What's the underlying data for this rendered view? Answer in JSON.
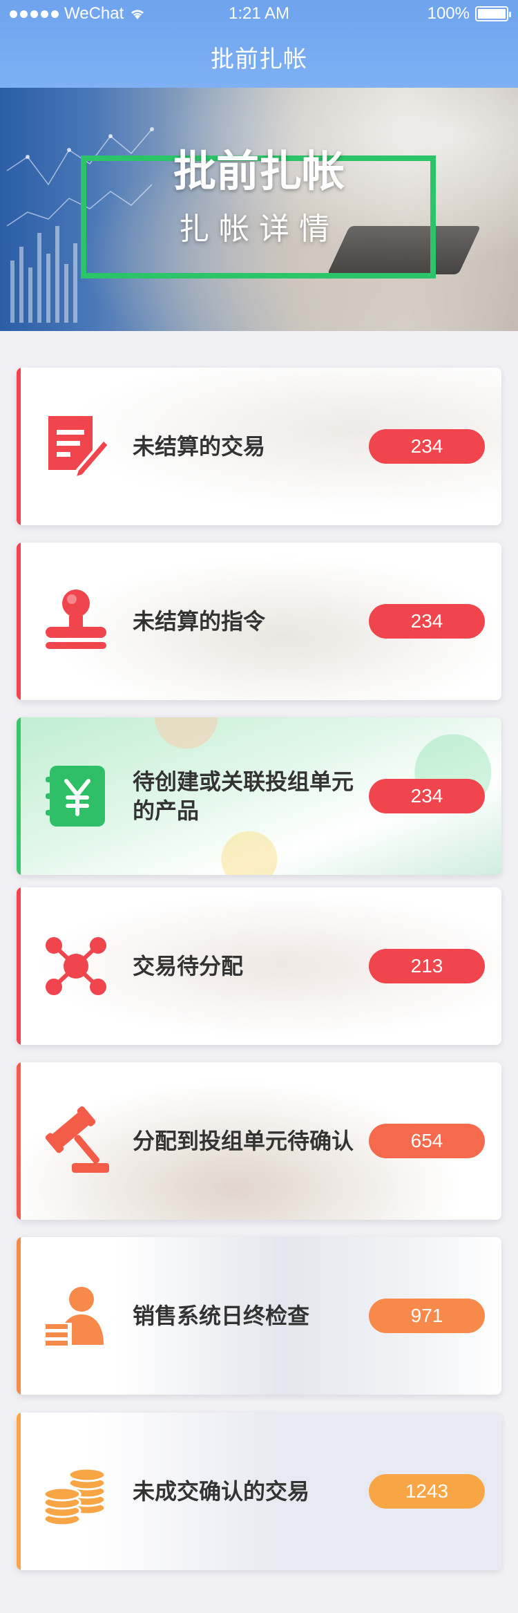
{
  "status_bar": {
    "carrier": "WeChat",
    "time": "1:21 AM",
    "battery": "100%"
  },
  "nav": {
    "title": "批前扎帐"
  },
  "banner": {
    "title": "批前扎帐",
    "subtitle": "扎帐详情"
  },
  "items": [
    {
      "label": "未结算的交易",
      "count": "234",
      "icon": "document-edit-icon",
      "accent": "#f0454d",
      "badge_color": "#f0454d"
    },
    {
      "label": "未结算的指令",
      "count": "234",
      "icon": "stamp-icon",
      "accent": "#f0454d",
      "badge_color": "#f0454d"
    },
    {
      "label": "待创建或关联投组单元的产品",
      "count": "234",
      "icon": "money-book-icon",
      "accent": "#3cc36d",
      "badge_color": "#f0454d"
    },
    {
      "label": "交易待分配",
      "count": "213",
      "icon": "network-nodes-icon",
      "accent": "#f0454d",
      "badge_color": "#f0454d"
    },
    {
      "label": "分配到投组单元待确认",
      "count": "654",
      "icon": "gavel-icon",
      "accent": "#f45c4a",
      "badge_color": "#f5694c"
    },
    {
      "label": "销售系统日终检查",
      "count": "971",
      "icon": "user-card-icon",
      "accent": "#f78a4a",
      "badge_color": "#f78a4a"
    },
    {
      "label": "未成交确认的交易",
      "count": "1243",
      "icon": "coin-stack-icon",
      "accent": "#f8a645",
      "badge_color": "#f8a645"
    }
  ]
}
